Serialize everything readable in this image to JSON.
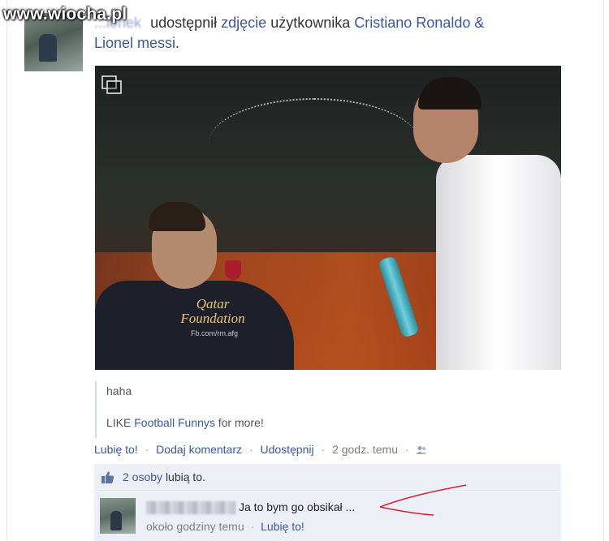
{
  "watermark": "www.wiocha.pl",
  "post": {
    "author_partial": "...lenek",
    "action_text": "udostępnił",
    "photo_link": "zdjęcie",
    "owner_prefix": "użytkownika",
    "owner_line1": "Cristiano Ronaldo &",
    "owner_line2": "Lionel messi",
    "owner_suffix": "."
  },
  "photo": {
    "shirt_sponsor_line1": "Qatar",
    "shirt_sponsor_line2": "Foundation",
    "shirt_url": "Fb.com/rm.afg"
  },
  "caption": {
    "line1": "haha",
    "line2_prefix": "LIKE ",
    "line2_link": "Football Funnys",
    "line2_suffix": " for more!"
  },
  "actions": {
    "like": "Lubię to!",
    "comment": "Dodaj komentarz",
    "share": "Udostępnij",
    "timestamp": "2 godz. temu",
    "separator": "·"
  },
  "likes": {
    "count_link": "2 osoby",
    "suffix": "lubią to."
  },
  "comment": {
    "text": "Ja to bym go obsikał ...",
    "time": "około godziny temu",
    "like": "Lubię to!",
    "separator": "·"
  },
  "colors": {
    "link": "#3b5998",
    "panel_bg": "#eceff5",
    "annotation_arrow": "#d2273a"
  },
  "icons": {
    "album": "album-icon",
    "audience": "friends-icon",
    "thumbs_up": "thumbs-up-icon"
  }
}
